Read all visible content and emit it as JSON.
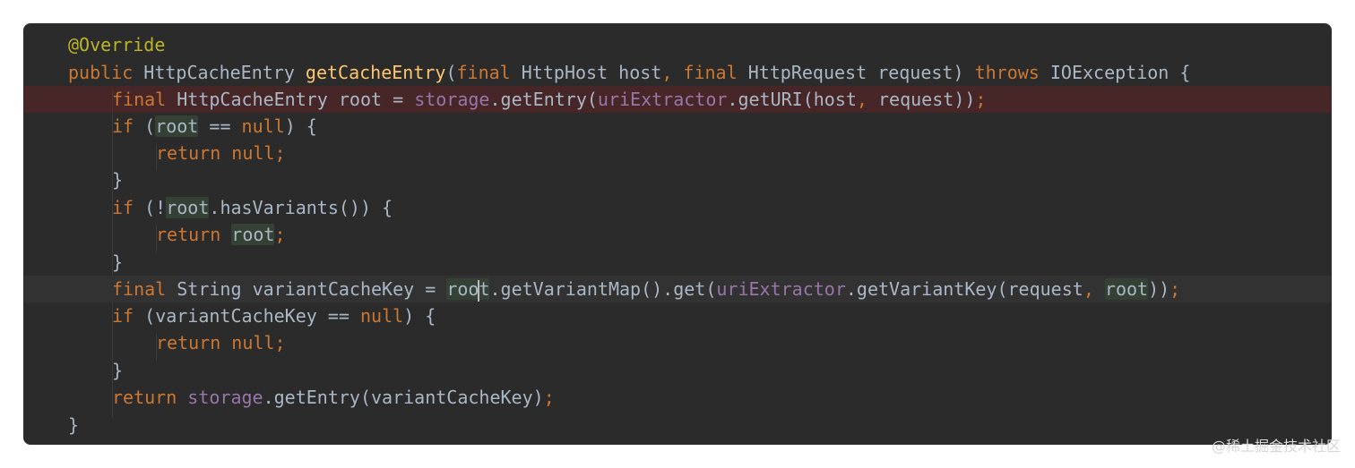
{
  "code": {
    "annotation": "@Override",
    "kw_public": "public",
    "type_HttpCacheEntry": "HttpCacheEntry",
    "method_getCacheEntry": "getCacheEntry",
    "kw_final": "final",
    "type_HttpHost": "HttpHost",
    "param_host": "host",
    "type_HttpRequest": "HttpRequest",
    "param_request": "request",
    "kw_throws": "throws",
    "type_IOException": "IOException",
    "var_root": "root",
    "field_storage": "storage",
    "call_getEntry": "getEntry",
    "field_uriExtractor": "uriExtractor",
    "call_getURI": "getURI",
    "kw_if": "if",
    "kw_null": "null",
    "kw_return": "return",
    "call_hasVariants": "hasVariants",
    "type_String": "String",
    "var_variantCacheKey": "variantCacheKey",
    "call_getVariantMap": "getVariantMap",
    "call_get": "get",
    "call_getVariantKey": "getVariantKey",
    "root_before_caret": "roo",
    "root_after_caret": "t"
  },
  "watermark": "@稀土掘金技术社区",
  "colors": {
    "background": "#2b2b2b",
    "keyword": "#cc7832",
    "annotation": "#bbb529",
    "method_declaration": "#ffc66d",
    "field": "#9876aa",
    "default_text": "#a9b7c6",
    "identifier_highlight": "#344134",
    "error_line": "#4a2424"
  }
}
